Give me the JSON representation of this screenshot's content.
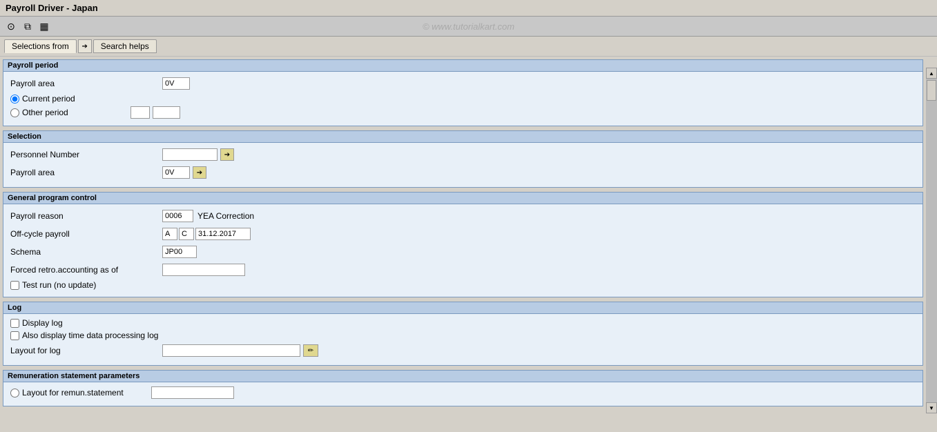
{
  "title": "Payroll Driver - Japan",
  "watermark": "© www.tutorialkart.com",
  "toolbar": {
    "icons": [
      "clock-icon",
      "copy-icon",
      "save-icon"
    ]
  },
  "tabs": {
    "selections_from_label": "Selections from",
    "search_helps_label": "Search helps"
  },
  "sections": {
    "payroll_period": {
      "title": "Payroll period",
      "payroll_area_label": "Payroll area",
      "payroll_area_value": "0V",
      "current_period_label": "Current period",
      "other_period_label": "Other period",
      "other_period_val1": "",
      "other_period_val2": ""
    },
    "selection": {
      "title": "Selection",
      "personnel_number_label": "Personnel Number",
      "personnel_number_value": "",
      "payroll_area_label": "Payroll area",
      "payroll_area_value": "0V"
    },
    "general_program_control": {
      "title": "General program control",
      "payroll_reason_label": "Payroll reason",
      "payroll_reason_code": "0006",
      "payroll_reason_text": "YEA Correction",
      "off_cycle_label": "Off-cycle payroll",
      "off_cycle_val1": "A",
      "off_cycle_val2": "C",
      "off_cycle_date": "31.12.2017",
      "schema_label": "Schema",
      "schema_value": "JP00",
      "forced_retro_label": "Forced retro.accounting as of",
      "forced_retro_value": "",
      "test_run_label": "Test run (no update)"
    },
    "log": {
      "title": "Log",
      "display_log_label": "Display log",
      "also_display_label": "Also display time data processing log",
      "layout_label": "Layout for log",
      "layout_value": ""
    },
    "remuneration": {
      "title": "Remuneration statement parameters",
      "layout_remun_label": "Layout for remun.statement",
      "layout_remun_value": ""
    }
  },
  "icons": {
    "arrow_right": "➔",
    "arrow_up": "▲",
    "arrow_down": "▼",
    "pencil": "✏",
    "clock": "⊙",
    "copy": "⧉",
    "save": "💾"
  }
}
